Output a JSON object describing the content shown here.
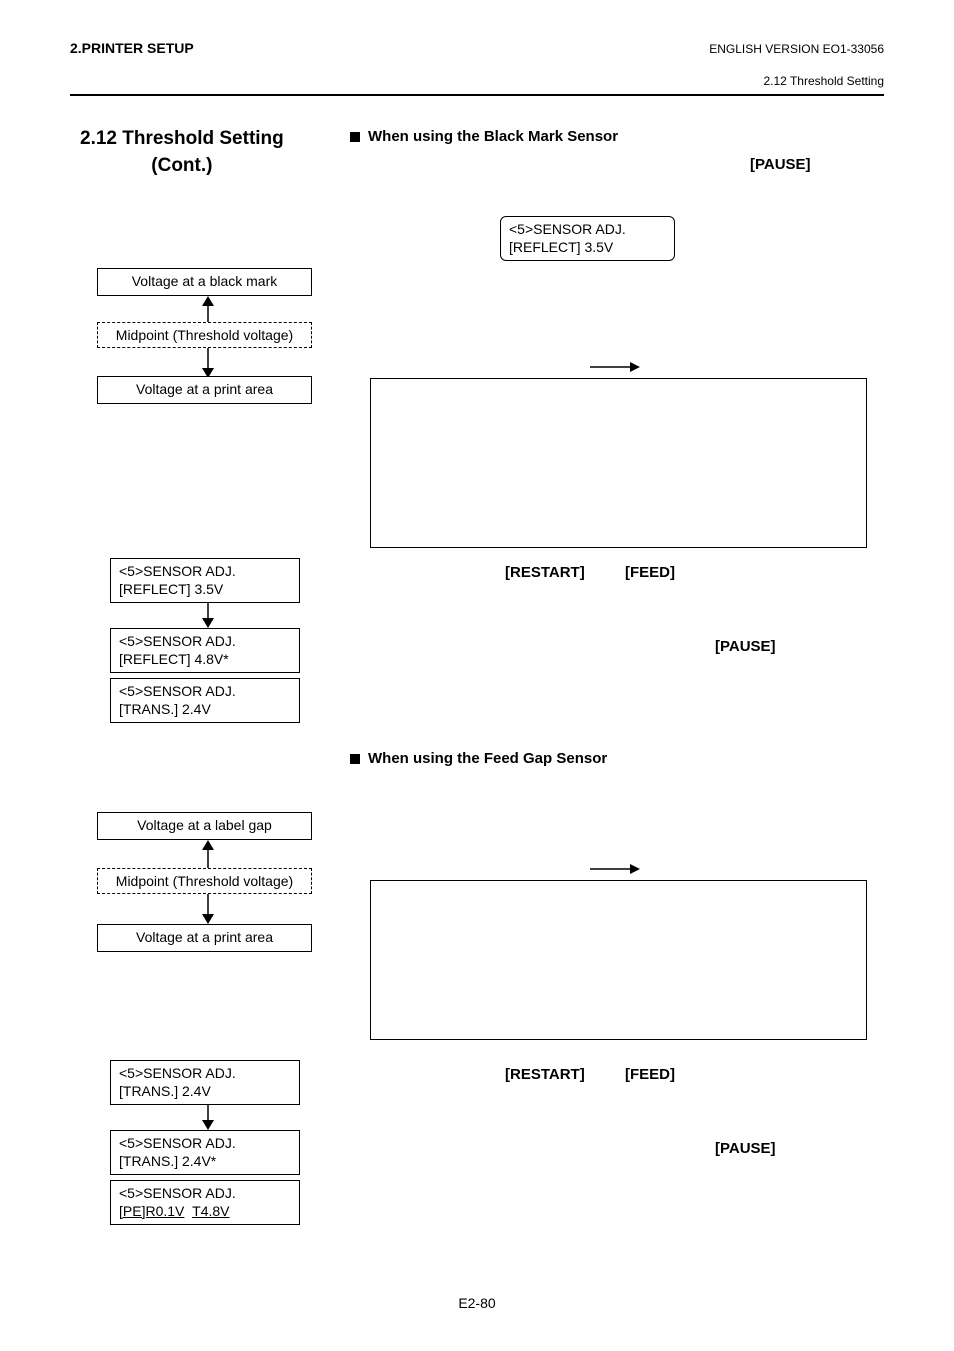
{
  "header": {
    "left": "2.PRINTER SETUP",
    "right": "ENGLISH VERSION EO1-33056",
    "sub_right": "2.12 Threshold Setting"
  },
  "section": {
    "title_line1": "2.12 Threshold Setting",
    "title_line2": "(Cont.)"
  },
  "black_mark": {
    "heading": "When using the Black Mark Sensor",
    "pause": "[PAUSE]",
    "lcd_top_l1": "<5>SENSOR ADJ.",
    "lcd_top_l2": "[REFLECT] 3.5V",
    "v_black_mark": "Voltage at a black mark",
    "midpoint": "Midpoint (Threshold voltage)",
    "v_print_area": "Voltage at a print area",
    "restart": "[RESTART]",
    "feed": "[FEED]",
    "pause2": "[PAUSE]",
    "seq1_l1": "<5>SENSOR ADJ.",
    "seq1_l2": "[REFLECT] 3.5V",
    "seq2_l1": "<5>SENSOR ADJ.",
    "seq2_l2": "[REFLECT] 4.8V*",
    "seq3_l1": "<5>SENSOR ADJ.",
    "seq3_l2": "[TRANS.] 2.4V"
  },
  "feed_gap": {
    "heading": "When using the Feed Gap Sensor",
    "v_label_gap": "Voltage at a label gap",
    "midpoint": "Midpoint (Threshold voltage)",
    "v_print_area": "Voltage at a print area",
    "restart": "[RESTART]",
    "feed": "[FEED]",
    "pause2": "[PAUSE]",
    "seq1_l1": "<5>SENSOR ADJ.",
    "seq1_l2": "[TRANS.] 2.4V",
    "seq2_l1": "<5>SENSOR ADJ.",
    "seq2_l2": "[TRANS.] 2.4V*",
    "seq3_l1": "<5>SENSOR ADJ.",
    "seq3_l2a": "[PE]R0.1V",
    "seq3_l2b": "T4.8V"
  },
  "footer": "E2-80"
}
